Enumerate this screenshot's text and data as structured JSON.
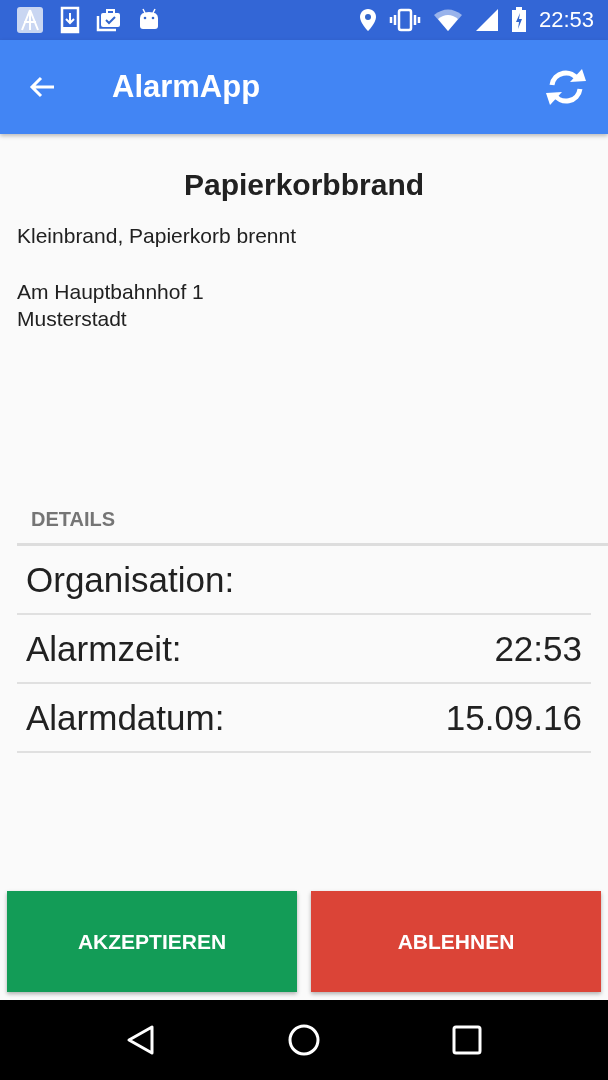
{
  "status_bar": {
    "time": "22:53"
  },
  "app_bar": {
    "title": "AlarmApp"
  },
  "alarm": {
    "title": "Papierkorbbrand",
    "description": "Kleinbrand, Papierkorb brennt",
    "address": [
      "Am Hauptbahnhof 1",
      "Musterstadt"
    ]
  },
  "details": {
    "heading": "DETAILS",
    "rows": [
      {
        "label": "Organisation:"
      },
      {
        "label": "Alarmzeit:",
        "value": "22:53"
      },
      {
        "label": "Alarmdatum:",
        "value": "15.09.16"
      }
    ]
  },
  "buttons": [
    {
      "label": "AKZEPTIEREN",
      "kind": "accept"
    },
    {
      "label": "ABLEHNEN",
      "kind": "decline"
    }
  ]
}
